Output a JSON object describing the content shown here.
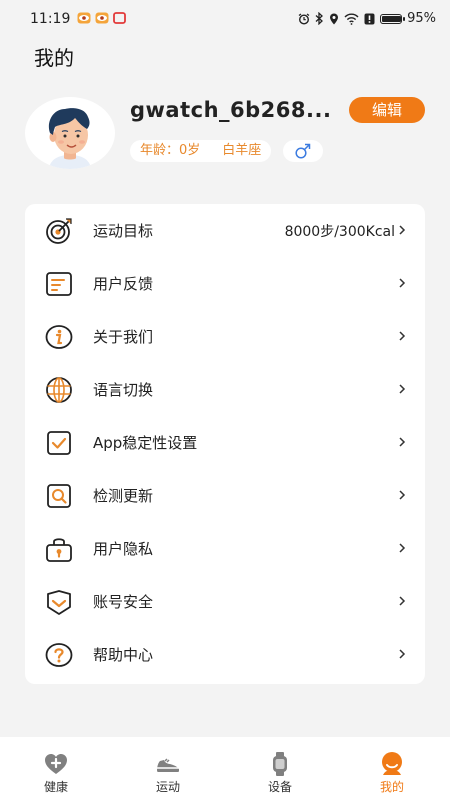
{
  "status_bar": {
    "time": "11:19",
    "battery_text": "95%",
    "battery_level": 0.95
  },
  "header": {
    "title": "我的"
  },
  "profile": {
    "username": "gwatch_6b268...",
    "edit_label": "编辑",
    "age_text": "年龄：0岁",
    "zodiac_text": "白羊座",
    "gender_icon": "male-icon"
  },
  "menu": {
    "items": [
      {
        "label": "运动目标",
        "value": "8000步/300Kcal",
        "icon": "target-icon"
      },
      {
        "label": "用户反馈",
        "value": "",
        "icon": "feedback-icon"
      },
      {
        "label": "关于我们",
        "value": "",
        "icon": "info-icon"
      },
      {
        "label": "语言切换",
        "value": "",
        "icon": "globe-icon"
      },
      {
        "label": "App稳定性设置",
        "value": "",
        "icon": "checkbox-icon"
      },
      {
        "label": "检测更新",
        "value": "",
        "icon": "search-update-icon"
      },
      {
        "label": "用户隐私",
        "value": "",
        "icon": "privacy-lock-icon"
      },
      {
        "label": "账号安全",
        "value": "",
        "icon": "shield-icon"
      },
      {
        "label": "帮助中心",
        "value": "",
        "icon": "help-icon"
      }
    ]
  },
  "tab_bar": {
    "tabs": [
      {
        "label": "健康",
        "icon": "health-heart-icon",
        "active": false
      },
      {
        "label": "运动",
        "icon": "sneaker-icon",
        "active": false
      },
      {
        "label": "设备",
        "icon": "watch-icon",
        "active": false
      },
      {
        "label": "我的",
        "icon": "profile-icon",
        "active": true
      }
    ]
  },
  "colors": {
    "accent": "#f07a16",
    "chip_text": "#e8892c",
    "background": "#f3f3f3"
  }
}
